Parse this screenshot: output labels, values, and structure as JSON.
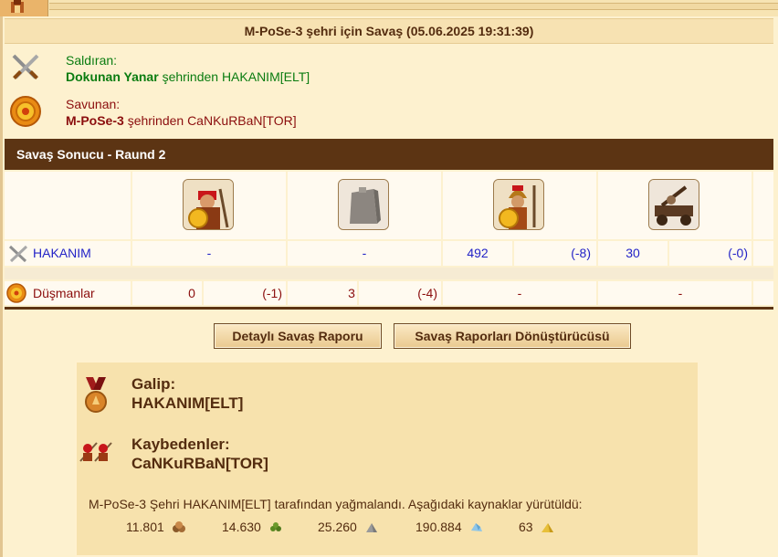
{
  "window": {
    "title": "M-PoSe-3 şehri için Savaş (05.06.2025 19:31:39)"
  },
  "attacker": {
    "label": "Saldıran:",
    "city": "Dokunan Yanar",
    "rest": "şehrinden HAKANIM[ELT]",
    "icon": "crossed-swords-icon"
  },
  "defender": {
    "label": "Savunan:",
    "city": "M-PoSe-3",
    "rest": "şehrinden CaNKuRBaN[TOR]",
    "icon": "shield-icon"
  },
  "result": {
    "header": "Savaş Sonucu - Raund 2",
    "units": [
      {
        "icon": "spearman-unit-icon"
      },
      {
        "icon": "wall-unit-icon"
      },
      {
        "icon": "hoplite-unit-icon"
      },
      {
        "icon": "catapult-unit-icon"
      }
    ],
    "rows": [
      {
        "name": "HAKANIM",
        "icon": "crossed-swords-icon",
        "cells": [
          {
            "value": "-",
            "loss": ""
          },
          {
            "value": "-",
            "loss": ""
          },
          {
            "value": "492",
            "loss": "(-8)"
          },
          {
            "value": "30",
            "loss": "(-0)"
          }
        ]
      },
      {
        "name": "Düşmanlar",
        "icon": "shield-icon",
        "cells": [
          {
            "value": "0",
            "loss": "(-1)"
          },
          {
            "value": "3",
            "loss": "(-4)"
          },
          {
            "value": "-",
            "loss": ""
          },
          {
            "value": "-",
            "loss": ""
          }
        ]
      }
    ]
  },
  "buttons": {
    "detailed_report": "Detaylı Savaş Raporu",
    "report_converter": "Savaş Raporları Dönüştürücüsü"
  },
  "summary": {
    "winner_label": "Galip:",
    "winner_name": "HAKANIM[ELT]",
    "loser_label": "Kaybedenler:",
    "loser_name": "CaNKuRBaN[TOR]",
    "plunder_text": "M-PoSe-3 Şehri HAKANIM[ELT] tarafından yağmalandı. Aşağıdaki kaynaklar yürütüldü:",
    "resources": [
      {
        "amount": "11.801",
        "icon": "wood-icon"
      },
      {
        "amount": "14.630",
        "icon": "wine-icon"
      },
      {
        "amount": "25.260",
        "icon": "marble-icon"
      },
      {
        "amount": "190.884",
        "icon": "crystal-icon"
      },
      {
        "amount": "63",
        "icon": "sulfur-icon"
      }
    ]
  },
  "colors": {
    "attacker_green": "#0a7c10",
    "defender_red": "#8b0e0e",
    "unit_number_blue": "#2323c7",
    "header_brown": "#5c3413"
  }
}
